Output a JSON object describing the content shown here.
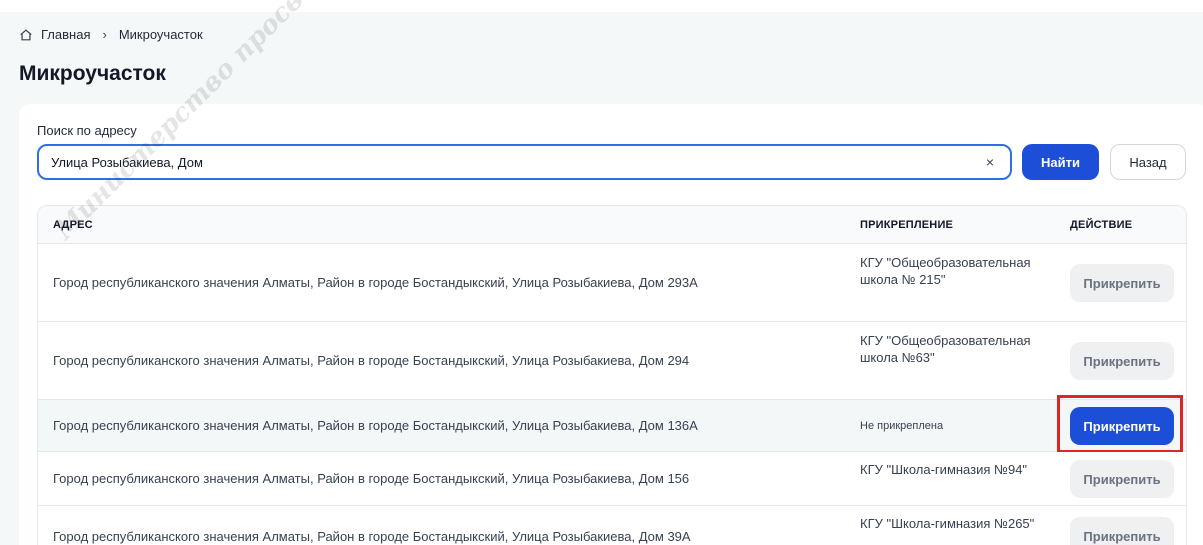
{
  "breadcrumb": {
    "home": "Главная",
    "separator": "›",
    "current": "Микроучасток"
  },
  "page_title": "Микроучасток",
  "search": {
    "label": "Поиск по адресу",
    "value": "Улица Розыбакиева, Дом",
    "clear_icon": "×",
    "find_button": "Найти",
    "back_button": "Назад"
  },
  "table": {
    "headers": {
      "address": "АДРЕС",
      "attachment": "ПРИКРЕПЛЕНИЕ",
      "action": "ДЕЙСТВИЕ"
    },
    "rows": [
      {
        "address": "Город республиканского значения Алматы, Район в городе Бостандыкский, Улица Розыбакиева, Дом 293А",
        "attachment": "КГУ \"Общеобразовательная школа № 215\"",
        "action": "Прикрепить"
      },
      {
        "address": "Город республиканского значения Алматы, Район в городе Бостандыкский, Улица Розыбакиева, Дом 294",
        "attachment": "КГУ \"Общеобразовательная школа №63\"",
        "action": "Прикрепить"
      },
      {
        "address": "Город республиканского значения Алматы, Район в городе Бостандыкский, Улица Розыбакиева, Дом 136А",
        "attachment": "Не прикреплена",
        "action": "Прикрепить"
      },
      {
        "address": "Город республиканского значения Алматы, Район в городе Бостандыкский, Улица Розыбакиева, Дом 156",
        "attachment": "КГУ \"Школа-гимназия №94\"",
        "action": "Прикрепить"
      },
      {
        "address": "Город республиканского значения Алматы, Район в городе Бостандыкский, Улица Розыбакиева, Дом 39А",
        "attachment": "КГУ \"Школа-гимназия №265\"",
        "action": "Прикрепить"
      }
    ]
  },
  "watermark": "Министерство просвещения Республики Казахстан",
  "colors": {
    "accent": "#1d4ed8",
    "highlight_frame": "#e02424",
    "page_bg": "#f4f8f8"
  }
}
